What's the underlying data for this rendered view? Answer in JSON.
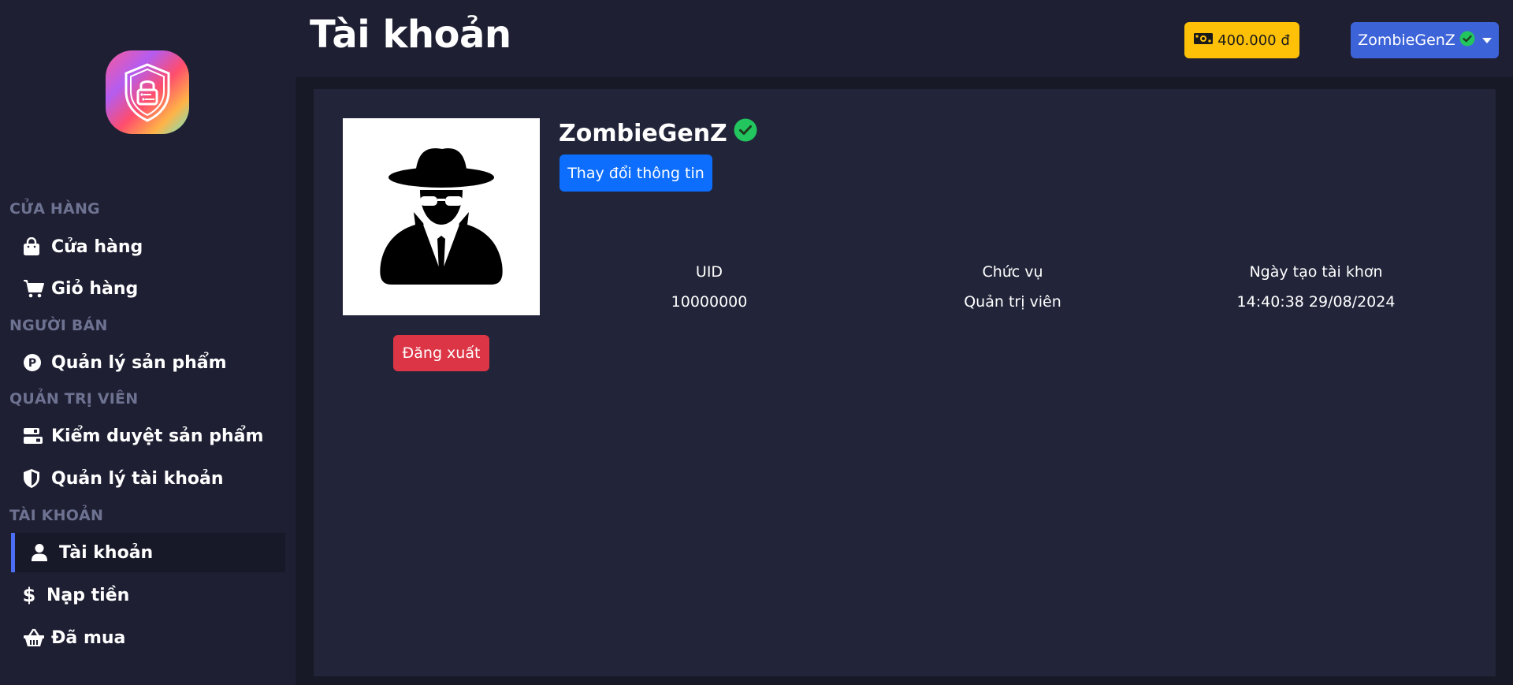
{
  "header": {
    "title": "Tài khoản",
    "balance": "400.000 đ",
    "user_name": "ZombieGenZ"
  },
  "sidebar": {
    "sections": [
      {
        "label": "CỬA HÀNG",
        "items": [
          {
            "label": "Cửa hàng",
            "icon": "shopping-bag-icon"
          },
          {
            "label": "Giỏ hàng",
            "icon": "cart-icon"
          }
        ]
      },
      {
        "label": "NGƯỜI BÁN",
        "items": [
          {
            "label": "Quản lý sản phẩm",
            "icon": "product-p-icon"
          }
        ]
      },
      {
        "label": "QUẢN TRỊ VIÊN",
        "items": [
          {
            "label": "Kiểm duyệt sản phẩm",
            "icon": "moderation-icon"
          },
          {
            "label": "Quản lý tài khoản",
            "icon": "shield-icon"
          }
        ]
      },
      {
        "label": "TÀI KHOẢN",
        "items": [
          {
            "label": "Tài khoản",
            "icon": "user-icon",
            "active": true
          },
          {
            "label": "Nạp tiền",
            "icon": "dollar-icon"
          },
          {
            "label": "Đã mua",
            "icon": "basket-icon"
          }
        ]
      }
    ]
  },
  "profile": {
    "username": "ZombieGenZ",
    "edit_label": "Thay đổi thông tin",
    "logout_label": "Đăng xuất",
    "fields": [
      {
        "label": "UID",
        "value": "10000000"
      },
      {
        "label": "Chức vụ",
        "value": "Quản trị viên"
      },
      {
        "label": "Ngày tạo tài khơn",
        "value": "14:40:38 29/08/2024"
      }
    ]
  },
  "colors": {
    "background": "#1e1f33",
    "card": "#222439",
    "balance": "#ffc107",
    "user_button": "#3d63d8",
    "primary": "#0d6efd",
    "danger": "#dc3545",
    "verified": "#22c55e",
    "active_indicator": "#4c6ef5"
  }
}
